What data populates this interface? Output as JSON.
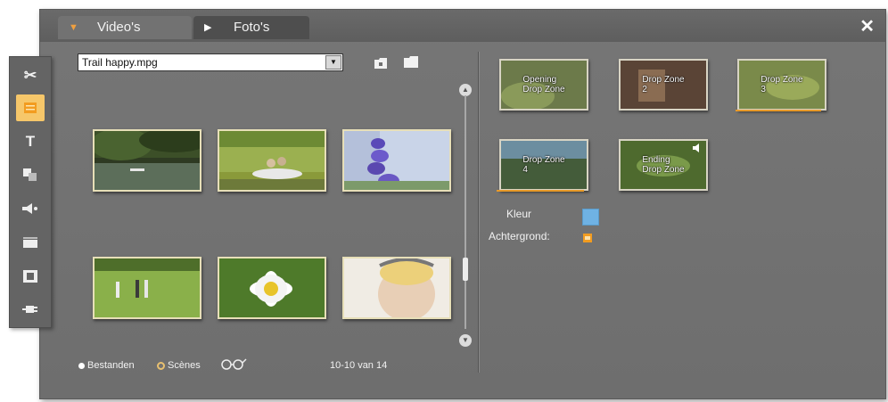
{
  "tabs": [
    {
      "label": "Video's",
      "active": true
    },
    {
      "label": "Foto's",
      "active": false
    }
  ],
  "close_label": "✕",
  "toolbar": [
    "scissors-icon",
    "menu-icon",
    "title-icon",
    "effects-icon",
    "audio-icon",
    "clapper-icon",
    "disc-icon",
    "plug-icon"
  ],
  "file_select": {
    "value": "Trail happy.mpg"
  },
  "clips": [
    {
      "scene": "lake-boat"
    },
    {
      "scene": "boat-people"
    },
    {
      "scene": "purple-flowers"
    },
    {
      "scene": "hikers-field"
    },
    {
      "scene": "daisy"
    },
    {
      "scene": "cyclist"
    }
  ],
  "bottom": {
    "files_label": "Bestanden",
    "scenes_label": "Scènes",
    "count": "10-10 van 14"
  },
  "menu_buttons": [
    {
      "caption": "Opening\nDrop Zone",
      "progress": 0
    },
    {
      "caption": "Drop Zone\n2",
      "progress": 0
    },
    {
      "caption": "Drop Zone\n3",
      "progress": 1
    },
    {
      "caption": "Drop Zone\n4",
      "progress": 1
    },
    {
      "caption": "Ending\nDrop Zone",
      "progress": 0
    }
  ],
  "props": {
    "color_label": "Kleur",
    "color_value": "#6fb2e4",
    "background_label": "Achtergrond:"
  },
  "colors": {
    "accent": "#f29c20",
    "panel": "#707070"
  }
}
